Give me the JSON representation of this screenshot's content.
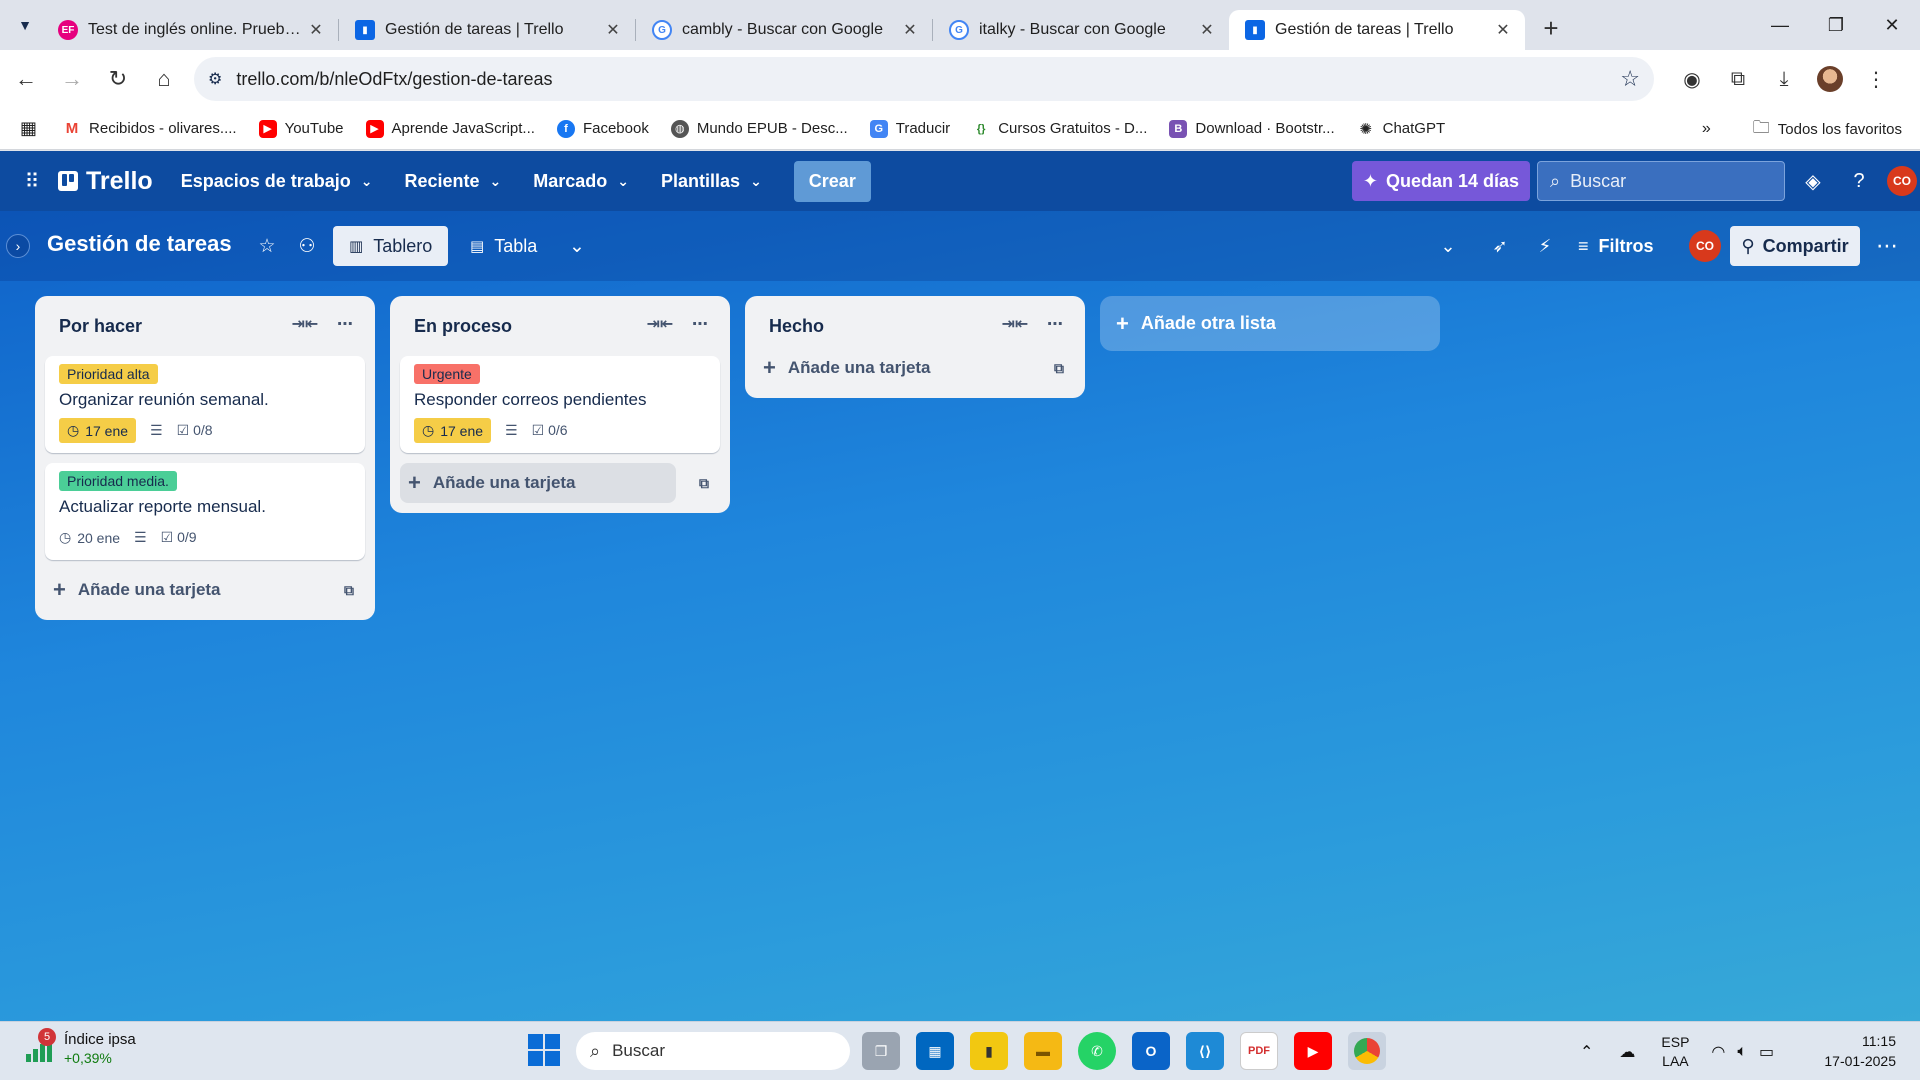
{
  "browser": {
    "tabs": [
      {
        "title": "Test de inglés online. Prueba of",
        "favicon": "ef-icon",
        "active": false
      },
      {
        "title": "Gestión de tareas | Trello",
        "favicon": "trello-icon",
        "active": false
      },
      {
        "title": "cambly - Buscar con Google",
        "favicon": "google-icon",
        "active": false
      },
      {
        "title": "italky - Buscar con Google",
        "favicon": "google-icon",
        "active": false
      },
      {
        "title": "Gestión de tareas | Trello",
        "favicon": "trello-icon",
        "active": true
      }
    ],
    "url": "trello.com/b/nleOdFtx/gestion-de-tareas",
    "bookmarks": [
      {
        "label": "Recibidos - olivares....",
        "icon": "gmail-icon"
      },
      {
        "label": "YouTube",
        "icon": "youtube-icon"
      },
      {
        "label": "Aprende JavaScript...",
        "icon": "youtube-icon"
      },
      {
        "label": "Facebook",
        "icon": "facebook-icon"
      },
      {
        "label": "Mundo EPUB - Desc...",
        "icon": "globe-icon"
      },
      {
        "label": "Traducir",
        "icon": "translate-icon"
      },
      {
        "label": "Cursos Gratuitos - D...",
        "icon": "code-icon"
      },
      {
        "label": "Download · Bootstr...",
        "icon": "bootstrap-icon"
      },
      {
        "label": "ChatGPT",
        "icon": "openai-icon"
      }
    ],
    "all_bookmarks": "Todos los favoritos"
  },
  "trello": {
    "logo": "Trello",
    "menu": [
      "Espacios de trabajo",
      "Reciente",
      "Marcado",
      "Plantillas"
    ],
    "create": "Crear",
    "trial": "Quedan 14 días",
    "search_placeholder": "Buscar",
    "avatar_initials": "CO"
  },
  "board": {
    "title": "Gestión de tareas",
    "views": [
      {
        "label": "Tablero",
        "active": true
      },
      {
        "label": "Tabla",
        "active": false
      }
    ],
    "filters": "Filtros",
    "share": "Compartir",
    "add_list": "Añade otra lista",
    "add_card": "Añade una tarjeta",
    "lists": [
      {
        "title": "Por hacer",
        "cards": [
          {
            "label": "Prioridad alta",
            "label_color": "#f5cd47",
            "title": "Organizar reunión semanal.",
            "due": "17 ene",
            "due_style": "yellow",
            "checklist": "0/8"
          },
          {
            "label": "Prioridad media.",
            "label_color": "#4bce97",
            "title": "Actualizar reporte mensual.",
            "due": "20 ene",
            "due_style": "plain",
            "checklist": "0/9"
          }
        ]
      },
      {
        "title": "En proceso",
        "cards": [
          {
            "label": "Urgente",
            "label_color": "#f87168",
            "title": "Responder correos pendientes",
            "due": "17 ene",
            "due_style": "yellow",
            "checklist": "0/6"
          }
        ]
      },
      {
        "title": "Hecho",
        "cards": []
      }
    ]
  },
  "taskbar": {
    "stock_name": "Índice ipsa",
    "stock_change": "+0,39%",
    "stock_badge": "5",
    "search": "Buscar",
    "lang_1": "ESP",
    "lang_2": "LAA",
    "time": "11:15",
    "date": "17-01-2025"
  }
}
